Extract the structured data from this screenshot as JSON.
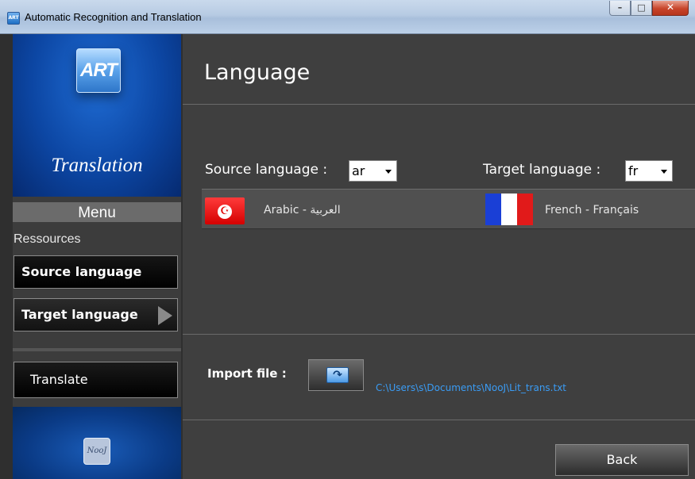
{
  "window": {
    "icon_text": "ART",
    "title": "Automatic Recognition and Translation",
    "minimize_glyph": "–",
    "maximize_glyph": "□",
    "close_glyph": "✕"
  },
  "sidebar": {
    "logo_text": "ART",
    "brand_word": "Translation",
    "menu_header": "Menu",
    "section_label": "Ressources",
    "items": [
      {
        "label": "Source language"
      },
      {
        "label": "Target language"
      }
    ],
    "translate_label": "Translate",
    "footer_logo_text": "NooJ"
  },
  "main": {
    "title": "Language",
    "source": {
      "label": "Source language :",
      "value": "ar",
      "language_name": "Arabic - العربية",
      "flag_symbol": "☪"
    },
    "target": {
      "label": "Target language :",
      "value": "fr",
      "language_name": "French - Français"
    },
    "import": {
      "label": "Import file :",
      "path": "C:\\Users\\s\\Documents\\NooJ\\Lit_trans.txt"
    },
    "back_label": "Back"
  },
  "colors": {
    "brand_blue": "#0c46a3",
    "link_blue": "#3a9cf5",
    "fr_blue": "#1a3fd6",
    "fr_white": "#ffffff",
    "fr_red": "#e11a1a"
  }
}
